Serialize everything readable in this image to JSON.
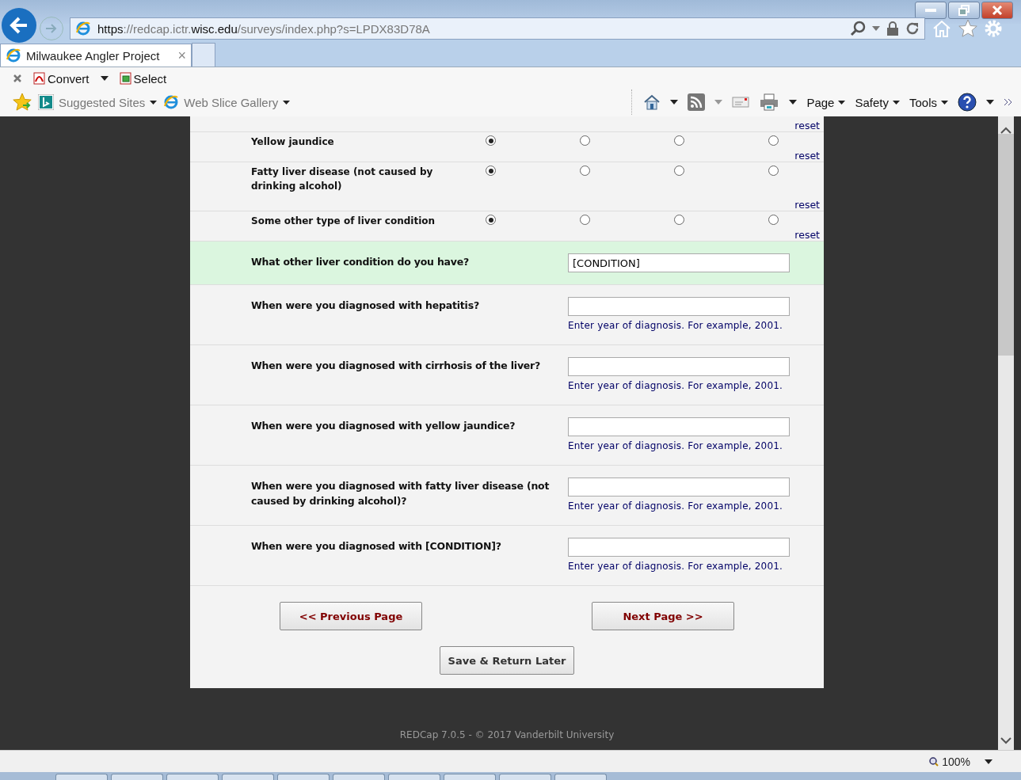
{
  "browser": {
    "url": "**https**://redcap.ictr.**wisc.edu**/surveys/index.php?s=LPDX83D78A",
    "tab": {
      "title": "Milwaukee Angler Project",
      "close": "×",
      "selected": true
    },
    "toolbar": [
      {
        "label": "Convert",
        "kind": "pdf"
      },
      {
        "label": "Select",
        "kind": "select"
      }
    ],
    "favorites": [
      {
        "label": "Suggested Sites",
        "kind": "bing"
      },
      {
        "label": "Web Slice Gallery",
        "kind": "ie"
      }
    ],
    "command_menus": [
      "Page",
      "Safety",
      "Tools"
    ],
    "zoom": "100%"
  },
  "survey": {
    "top_reset": "reset",
    "matrix_rows": [
      {
        "label": "Yellow jaundice",
        "choices": [
          {
            "selected": true
          },
          {
            "selected": false
          },
          {
            "selected": false
          },
          {
            "selected": false
          }
        ],
        "reset": "reset"
      },
      {
        "label": "Fatty liver disease (not caused by drinking alcohol)",
        "choices": [
          {
            "selected": true
          },
          {
            "selected": false
          },
          {
            "selected": false
          },
          {
            "selected": false
          }
        ],
        "reset": "reset"
      },
      {
        "label": "Some other type of liver condition",
        "choices": [
          {
            "selected": true
          },
          {
            "selected": false
          },
          {
            "selected": false
          },
          {
            "selected": false
          }
        ],
        "reset": "reset"
      }
    ],
    "questions": [
      {
        "label": "What other liver condition do you have?",
        "value": "[CONDITION]",
        "highlighted": true
      },
      {
        "label": "When were you diagnosed with hepatitis?",
        "note": "Enter year of diagnosis. For example, 2001.",
        "highlighted": false
      },
      {
        "label": "When were you diagnosed with cirrhosis of the liver?",
        "note": "Enter year of diagnosis. For example, 2001.",
        "highlighted": false
      },
      {
        "label": "When were you diagnosed with yellow jaundice?",
        "note": "Enter year of diagnosis. For example, 2001.",
        "highlighted": false
      },
      {
        "label": "When were you diagnosed with fatty liver disease (not caused by drinking alcohol)?",
        "note": "Enter year of diagnosis. For example, 2001.",
        "highlighted": false
      },
      {
        "label": "When were you diagnosed with [CONDITION]?",
        "note": "Enter year of diagnosis. For example, 2001.",
        "highlighted": false
      }
    ],
    "previous_button": "<< Previous Page",
    "next_button": "Next Page >>",
    "save_button": "Save & Return Later"
  },
  "footer": "REDCap 7.0.5 - © 2017 Vanderbilt University"
}
